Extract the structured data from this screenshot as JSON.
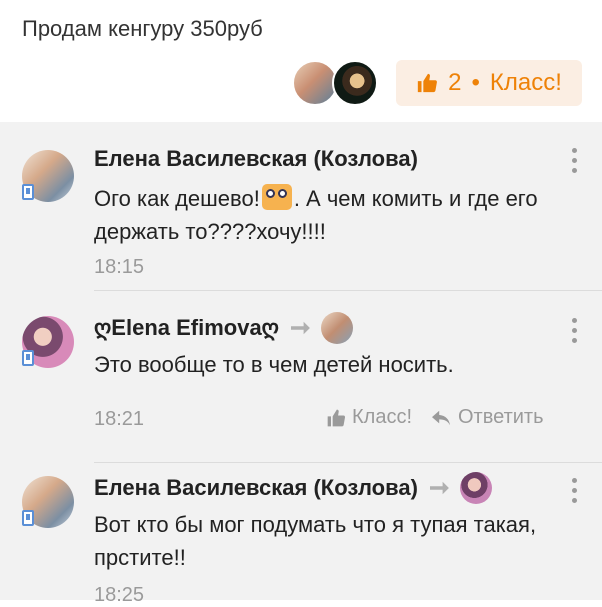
{
  "post": {
    "text": "Продам кенгуру 350руб",
    "like_count": "2",
    "like_separator": "•",
    "like_label": "Класс!"
  },
  "comments": [
    {
      "author": "Елена Василевская (Козлова)",
      "text_before_emoji": "Ого как дешево!",
      "text_after_emoji": ". А чем комить и где его держать то????хочу!!!!",
      "time": "18:15"
    },
    {
      "author": "ღElena Efimovaღ",
      "text": "Это вообще то в чем детей носить.",
      "time": "18:21",
      "like_label": "Класс!",
      "reply_label": "Ответить"
    },
    {
      "author": "Елена Василевская (Козлова)",
      "text": "Вот кто бы мог подумать что я тупая такая, прстите!!",
      "time": "18:25"
    }
  ],
  "colors": {
    "accent": "#ee8208",
    "pill_bg": "#fbeee3",
    "muted": "#9a9a9a",
    "comments_bg": "#f2f2f2"
  },
  "icons": [
    "thumbs-up-icon",
    "reply-arrow-icon",
    "more-vertical-icon",
    "online-badge-icon",
    "emoji-icon"
  ]
}
